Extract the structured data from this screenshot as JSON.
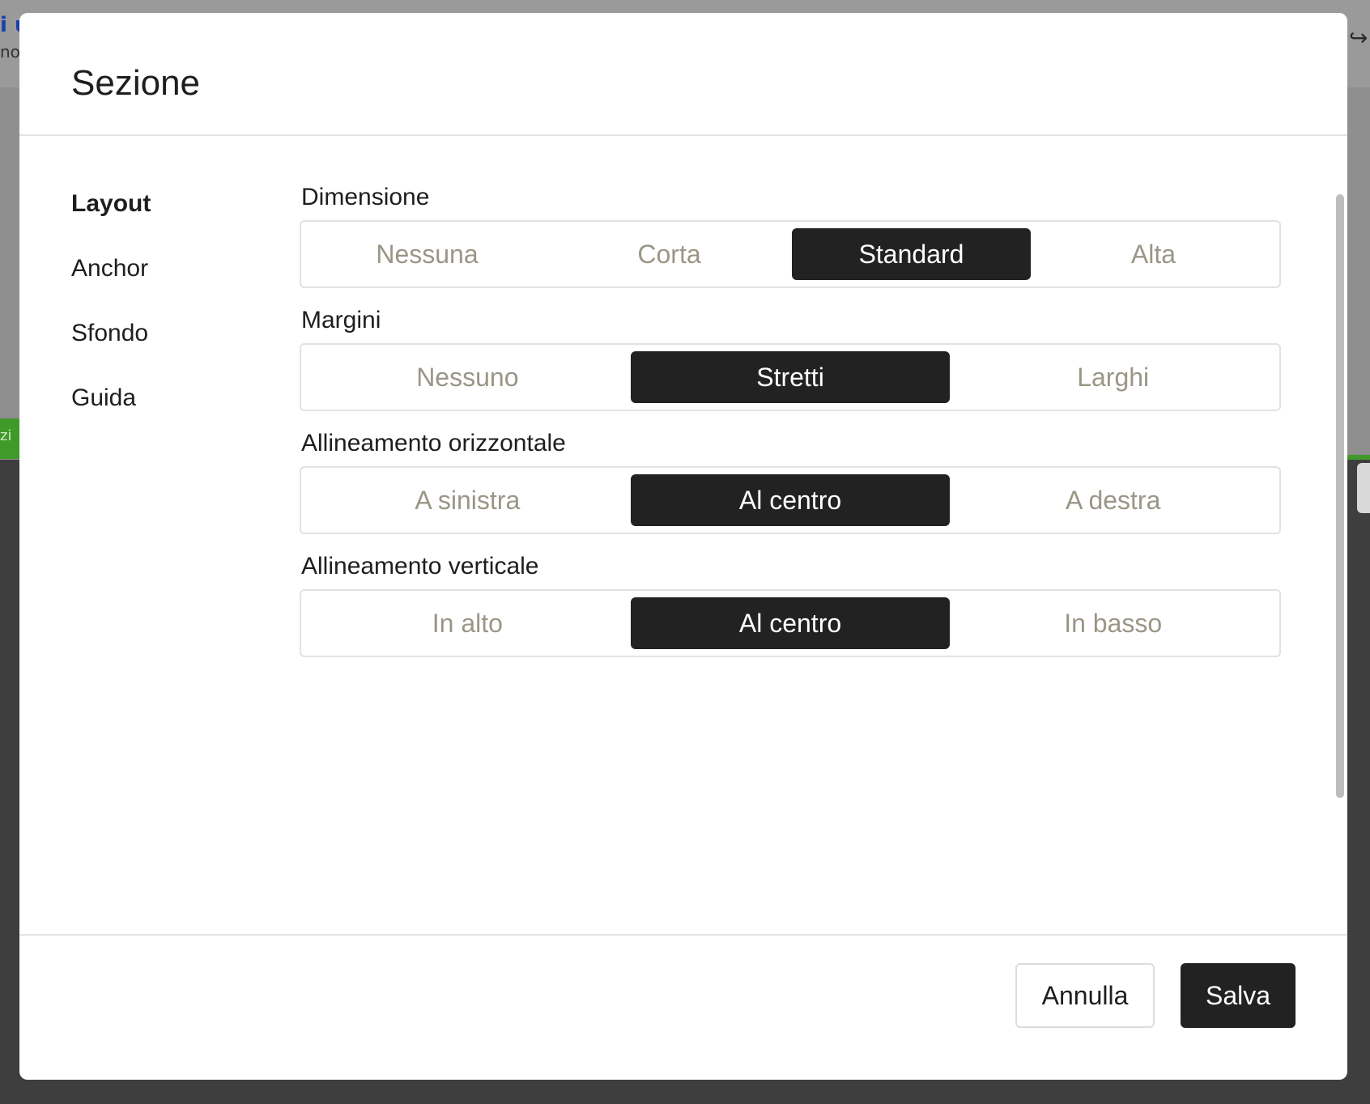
{
  "background": {
    "fragment_top": "i u",
    "fragment_sub": "no",
    "fragment_green": "zi"
  },
  "dialog": {
    "title": "Sezione",
    "nav": {
      "items": [
        {
          "label": "Layout",
          "active": true
        },
        {
          "label": "Anchor",
          "active": false
        },
        {
          "label": "Sfondo",
          "active": false
        },
        {
          "label": "Guida",
          "active": false
        }
      ]
    },
    "groups": [
      {
        "label": "Dimensione",
        "options": [
          "Nessuna",
          "Corta",
          "Standard",
          "Alta"
        ],
        "selected": "Standard"
      },
      {
        "label": "Margini",
        "options": [
          "Nessuno",
          "Stretti",
          "Larghi"
        ],
        "selected": "Stretti"
      },
      {
        "label": "Allineamento orizzontale",
        "options": [
          "A sinistra",
          "Al centro",
          "A destra"
        ],
        "selected": "Al centro"
      },
      {
        "label": "Allineamento verticale",
        "options": [
          "In alto",
          "Al centro",
          "In basso"
        ],
        "selected": "Al centro"
      }
    ],
    "footer": {
      "cancel_label": "Annulla",
      "save_label": "Salva"
    }
  },
  "colors": {
    "selected_bg": "#222222",
    "unselected_text": "#9a9687",
    "border": "#e2e2e2"
  }
}
